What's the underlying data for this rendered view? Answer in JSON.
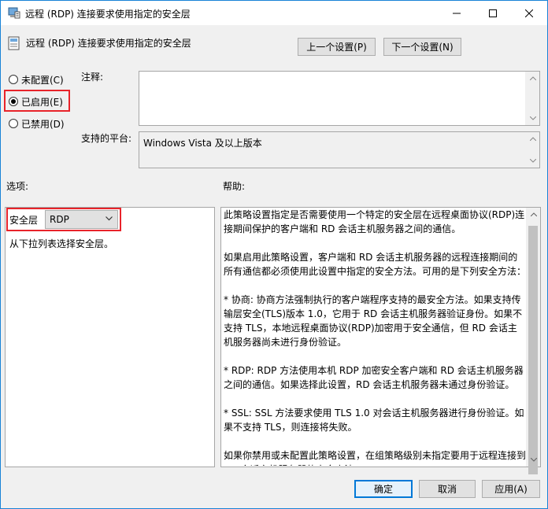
{
  "window": {
    "title": "远程 (RDP) 连接要求使用指定的安全层"
  },
  "header": {
    "title": "远程 (RDP) 连接要求使用指定的安全层",
    "prev_label": "上一个设置(P)",
    "next_label": "下一个设置(N)"
  },
  "state": {
    "not_configured": "未配置(C)",
    "enabled": "已启用(E)",
    "disabled": "已禁用(D)",
    "selected": "enabled"
  },
  "comment": {
    "label": "注释:",
    "value": ""
  },
  "platform": {
    "label": "支持的平台:",
    "value": "Windows Vista 及以上版本"
  },
  "options": {
    "label": "选项:",
    "security_layer_label": "安全层",
    "security_layer_value": "RDP",
    "hint": "从下拉列表选择安全层。"
  },
  "help": {
    "label": "帮助:",
    "paragraphs": [
      "此策略设置指定是否需要使用一个特定的安全层在远程桌面协议(RDP)连接期间保护的客户端和 RD 会话主机服务器之间的通信。",
      "如果启用此策略设置，客户端和 RD 会话主机服务器的远程连接期间的所有通信都必须使用此设置中指定的安全方法。可用的是下列安全方法：",
      " * 协商: 协商方法强制执行的客户端程序支持的最安全方法。如果支持传输层安全(TLS)版本 1.0，它用于 RD 会话主机服务器验证身份。如果不支持 TLS，本地远程桌面协议(RDP)加密用于安全通信，但 RD 会话主机服务器尚未进行身份验证。",
      " * RDP: RDP 方法使用本机 RDP 加密安全客户端和 RD 会话主机服务器之间的通信。如果选择此设置，RD 会话主机服务器未通过身份验证。",
      " * SSL: SSL 方法要求使用 TLS 1.0 对会话主机服务器进行身份验证。如果不支持 TLS，则连接将失败。",
      "如果你禁用或未配置此策略设置，在组策略级别未指定要用于远程连接到 RD 会话主机服务器的安全方法。"
    ]
  },
  "footer": {
    "ok_label": "确定",
    "cancel_label": "取消",
    "apply_label": "应用(A)"
  },
  "colors": {
    "accent": "#0078d7",
    "highlight_box": "#e8232a"
  },
  "icons": {
    "title": "policy-icon",
    "header": "policy-setting-icon",
    "minimize": "minimize-icon",
    "maximize": "maximize-icon",
    "close": "close-icon",
    "dropdown": "chevron-down-icon"
  }
}
